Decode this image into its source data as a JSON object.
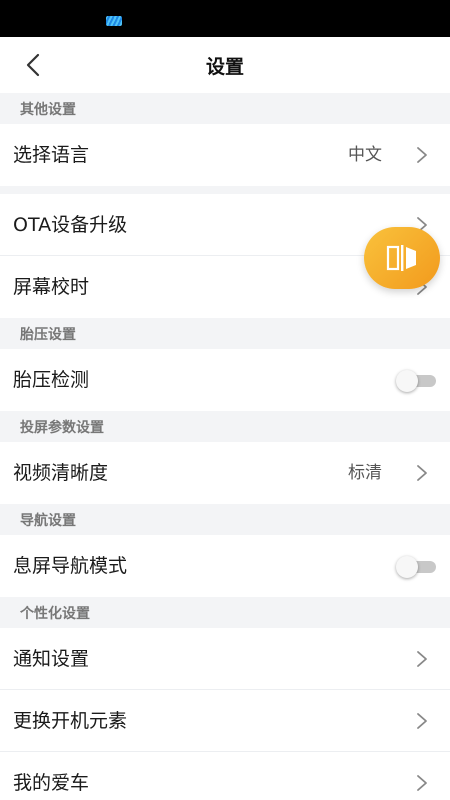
{
  "header": {
    "title": "设置"
  },
  "sections": {
    "other": {
      "header": "其他设置",
      "language": {
        "label": "选择语言",
        "value": "中文"
      },
      "ota": {
        "label": "OTA设备升级"
      },
      "time_sync": {
        "label": "屏幕校时"
      }
    },
    "tire": {
      "header": "胎压设置",
      "detect": {
        "label": "胎压检测",
        "enabled": false
      }
    },
    "cast": {
      "header": "投屏参数设置",
      "clarity": {
        "label": "视频清晰度",
        "value": "标清"
      }
    },
    "navigation": {
      "header": "导航设置",
      "screen_off_nav": {
        "label": "息屏导航模式",
        "enabled": false
      }
    },
    "personal": {
      "header": "个性化设置",
      "notifications": {
        "label": "通知设置"
      },
      "boot_elements": {
        "label": "更换开机元素"
      },
      "my_car": {
        "label": "我的爱车"
      }
    }
  },
  "floating_button": {
    "icon": "screen-mirror-icon",
    "color": "#f5a623"
  },
  "colors": {
    "background": "#f3f4f6",
    "accent": "#f5a623",
    "status_bar": "#000000"
  }
}
